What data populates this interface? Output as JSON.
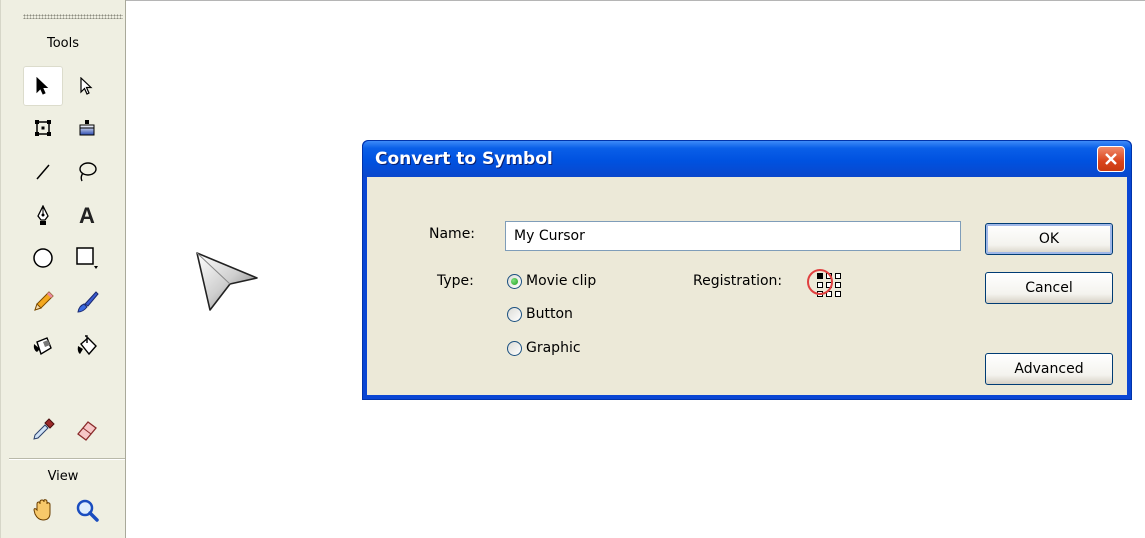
{
  "tools_panel": {
    "title": "Tools",
    "view_title": "View",
    "tools": [
      {
        "name": "selection-tool",
        "icon": "arrow-filled-icon"
      },
      {
        "name": "subselection-tool",
        "icon": "arrow-hollow-icon"
      },
      {
        "name": "free-transform-tool",
        "icon": "free-transform-icon"
      },
      {
        "name": "gradient-transform-tool",
        "icon": "gradient-transform-icon"
      },
      {
        "name": "line-tool",
        "icon": "line-icon"
      },
      {
        "name": "lasso-tool",
        "icon": "lasso-icon"
      },
      {
        "name": "pen-tool",
        "icon": "pen-icon"
      },
      {
        "name": "text-tool",
        "icon": "text-icon",
        "glyph": "A"
      },
      {
        "name": "oval-tool",
        "icon": "oval-icon"
      },
      {
        "name": "rectangle-tool",
        "icon": "rectangle-icon"
      },
      {
        "name": "pencil-tool",
        "icon": "pencil-icon"
      },
      {
        "name": "brush-tool",
        "icon": "brush-icon"
      },
      {
        "name": "ink-bottle-tool",
        "icon": "ink-bottle-icon"
      },
      {
        "name": "paint-bucket-tool",
        "icon": "paint-bucket-icon"
      },
      {
        "name": "eyedropper-tool",
        "icon": "eyedropper-icon"
      },
      {
        "name": "eraser-tool",
        "icon": "eraser-icon"
      },
      {
        "name": "hand-tool",
        "icon": "hand-icon"
      },
      {
        "name": "zoom-tool",
        "icon": "zoom-icon"
      }
    ]
  },
  "dialog": {
    "title": "Convert to Symbol",
    "name_label": "Name:",
    "name_value": "My Cursor",
    "type_label": "Type:",
    "type_options": [
      {
        "label": "Movie clip",
        "selected": true
      },
      {
        "label": "Button",
        "selected": false
      },
      {
        "label": "Graphic",
        "selected": false
      }
    ],
    "registration_label": "Registration:",
    "registration_selected": "top-left",
    "buttons": {
      "ok": "OK",
      "cancel": "Cancel",
      "advanced": "Advanced"
    }
  },
  "colors": {
    "titlebar": "#0052e0",
    "dialog_face": "#ece9d8",
    "panel_bg": "#efefe2",
    "close_button": "#d9441c",
    "highlight_circle": "#e04040"
  }
}
